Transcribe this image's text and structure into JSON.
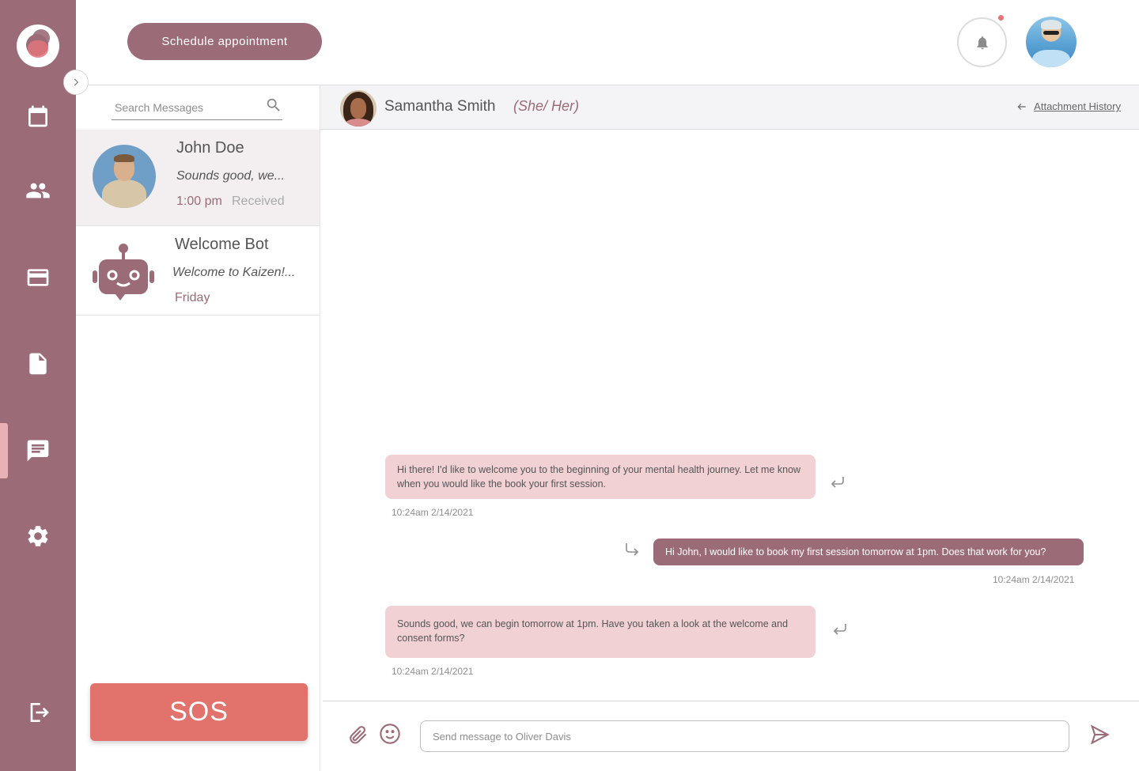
{
  "app": {
    "accent_color": "#9b6b78",
    "sos_color": "#e2736c"
  },
  "nav": {
    "items": [
      {
        "name": "calendar-icon"
      },
      {
        "name": "people-icon"
      },
      {
        "name": "credit-card-icon"
      },
      {
        "name": "document-icon"
      },
      {
        "name": "chat-icon",
        "active": true
      },
      {
        "name": "gear-icon"
      },
      {
        "name": "logout-icon"
      }
    ]
  },
  "topbar": {
    "schedule_label": "Schedule appointment"
  },
  "search": {
    "placeholder": "Search Messages"
  },
  "conversations": [
    {
      "name": "John Doe",
      "preview": "Sounds good, we...",
      "time": "1:00 pm",
      "status": "Received",
      "selected": true
    },
    {
      "name": "Welcome Bot",
      "preview": "Welcome to Kaizen!...",
      "time": "Friday",
      "status": ""
    }
  ],
  "sos_label": "SOS",
  "chat": {
    "contact_name": "Samantha Smith",
    "contact_pronouns": "(She/ Her)",
    "attachment_history_label": "Attachment History",
    "messages": [
      {
        "direction": "in",
        "text": "Hi there! I'd like to welcome you to the beginning of your mental health journey. Let me know when you would like the book your first session.",
        "timestamp": "10:24am 2/14/2021"
      },
      {
        "direction": "out",
        "text": "Hi John, I would like to book my first session tomorrow at 1pm. Does that work for you?",
        "timestamp": "10:24am 2/14/2021"
      },
      {
        "direction": "in",
        "text": "Sounds good, we can begin tomorrow at 1pm. Have you taken a look at the welcome and consent forms?",
        "timestamp": "10:24am 2/14/2021"
      }
    ],
    "composer_placeholder": "Send message to Oliver Davis"
  }
}
